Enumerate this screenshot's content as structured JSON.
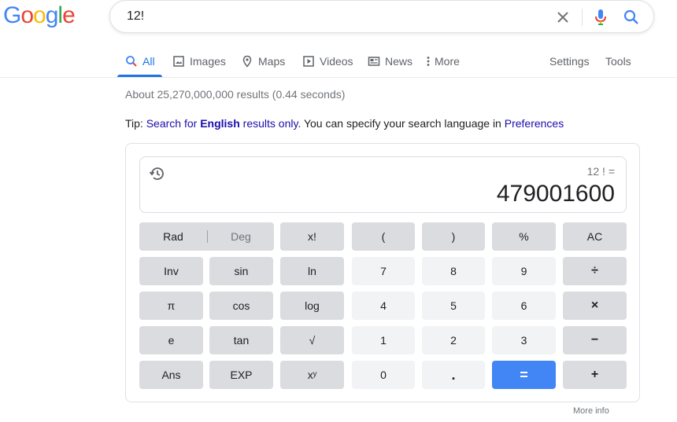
{
  "logo": {
    "letters": [
      "G",
      "o",
      "o",
      "g",
      "l",
      "e"
    ]
  },
  "search": {
    "query": "12!"
  },
  "tabs": [
    {
      "label": "All",
      "icon": "search-icon"
    },
    {
      "label": "Images",
      "icon": "image-icon"
    },
    {
      "label": "Maps",
      "icon": "map-pin-icon"
    },
    {
      "label": "Videos",
      "icon": "play-icon"
    },
    {
      "label": "News",
      "icon": "news-icon"
    },
    {
      "label": "More",
      "icon": "more-vert-icon"
    }
  ],
  "settings_label": "Settings",
  "tools_label": "Tools",
  "stats": "About 25,270,000,000 results (0.44 seconds)",
  "tip": {
    "prefix": "Tip: ",
    "link1": "Search for ",
    "bold": "English",
    "link1_end": " results only",
    "middle": ". You can specify your search language in ",
    "link2": "Preferences"
  },
  "calculator": {
    "expression": "12 ! =",
    "result": "479001600",
    "rad_label": "Rad",
    "deg_label": "Deg",
    "keys": {
      "fact": "x!",
      "lparen": "(",
      "rparen": ")",
      "percent": "%",
      "ac": "AC",
      "inv": "Inv",
      "sin": "sin",
      "ln": "ln",
      "seven": "7",
      "eight": "8",
      "nine": "9",
      "divide": "÷",
      "pi": "π",
      "cos": "cos",
      "log": "log",
      "four": "4",
      "five": "5",
      "six": "6",
      "multiply": "×",
      "e": "e",
      "tan": "tan",
      "sqrt": "√",
      "one": "1",
      "two": "2",
      "three": "3",
      "minus": "−",
      "ans": "Ans",
      "exp": "EXP",
      "power": "xʸ",
      "zero": "0",
      "dot": ".",
      "equals": "=",
      "plus": "+"
    }
  },
  "more_info": "More info",
  "colors": {
    "accent": "#1a73e8",
    "equals_key": "#4285f4",
    "link": "#1a0dab"
  }
}
